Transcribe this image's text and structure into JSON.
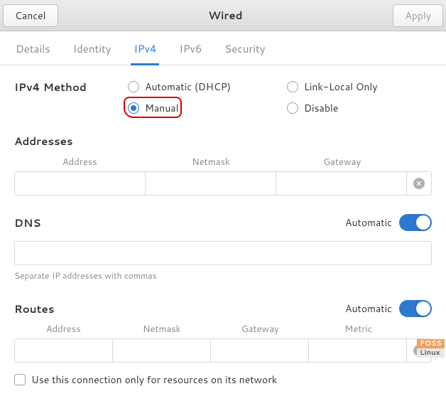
{
  "header": {
    "cancel": "Cancel",
    "title": "Wired",
    "apply": "Apply"
  },
  "tabs": {
    "details": "Details",
    "identity": "Identity",
    "ipv4": "IPv4",
    "ipv6": "IPv6",
    "security": "Security",
    "active": "ipv4"
  },
  "ipv4_method": {
    "label": "IPv4 Method",
    "options": {
      "auto": "Automatic (DHCP)",
      "link_local": "Link-Local Only",
      "manual": "Manual",
      "disable": "Disable"
    },
    "selected": "manual"
  },
  "addresses": {
    "title": "Addresses",
    "cols": {
      "address": "Address",
      "netmask": "Netmask",
      "gateway": "Gateway"
    },
    "rows": [
      {
        "address": "",
        "netmask": "",
        "gateway": ""
      }
    ]
  },
  "dns": {
    "title": "DNS",
    "auto_label": "Automatic",
    "auto_on": true,
    "value": "",
    "hint": "Separate IP addresses with commas"
  },
  "routes": {
    "title": "Routes",
    "auto_label": "Automatic",
    "auto_on": true,
    "cols": {
      "address": "Address",
      "netmask": "Netmask",
      "gateway": "Gateway",
      "metric": "Metric"
    },
    "rows": [
      {
        "address": "",
        "netmask": "",
        "gateway": "",
        "metric": ""
      }
    ],
    "only_resources": "Use this connection only for resources on its network",
    "only_resources_checked": false
  },
  "watermark": {
    "top": "FOSS",
    "bottom": "Linux"
  }
}
